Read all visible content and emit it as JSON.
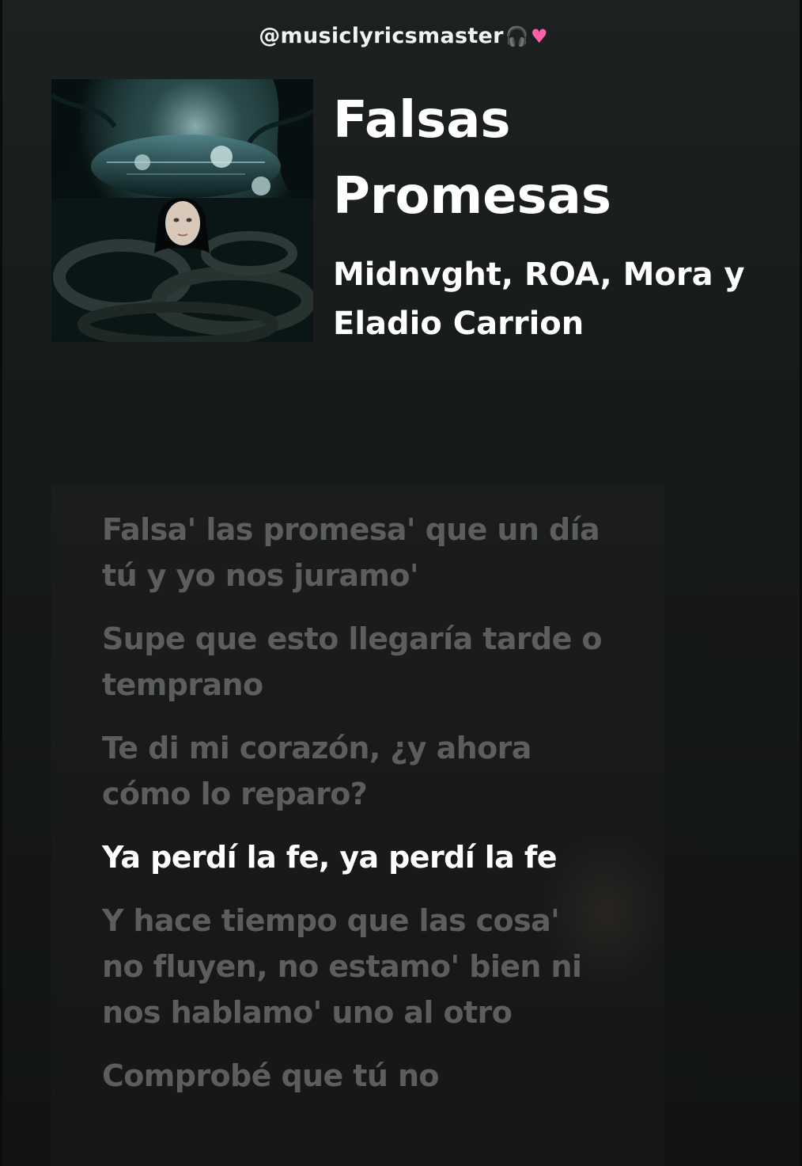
{
  "header": {
    "handle": "@musiclyricsmaster",
    "headphones_icon": "headphones-icon",
    "heart_icon": "pink-heart-icon"
  },
  "song": {
    "title": "Falsas Promesas",
    "artists": "Midnvght, ROA, Mora y Eladio Carrion"
  },
  "lyrics": {
    "lines": [
      "Falsa' las promesa' que un día tú y yo nos juramo'",
      "Supe que esto llegaría tarde o temprano",
      "Te di mi corazón, ¿y ahora cómo lo reparo?",
      "Ya perdí la fe, ya perdí la fe",
      "Y hace tiempo que las cosa' no fluyen, no estamo' bien ni nos hablamo' uno al otro",
      "Comprobé que tú no"
    ],
    "active_index": 3
  },
  "colors": {
    "background": "#171a1a",
    "active_lyric": "#ffffff",
    "inactive_lyric": "#5c5e5e",
    "heart": "#ff5fa8"
  }
}
